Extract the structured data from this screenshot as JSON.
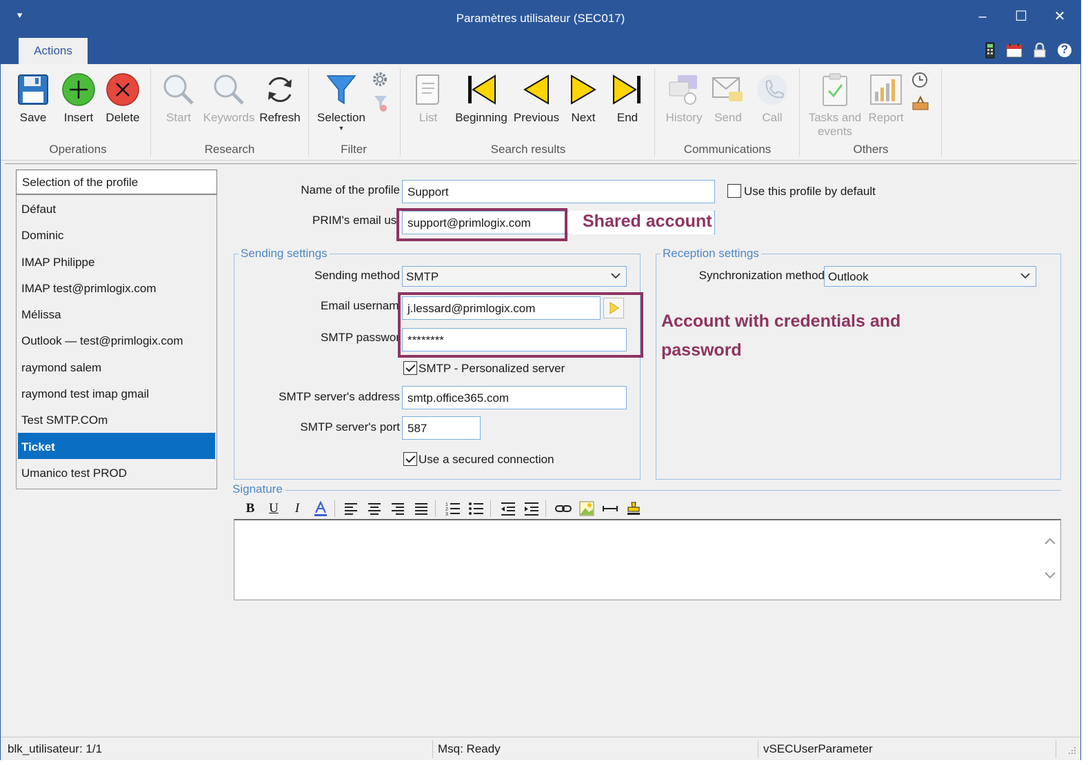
{
  "window": {
    "title": "Paramètres utilisateur (SEC017)",
    "system_menu_glyph": "⯆"
  },
  "window_controls": {
    "minimize": "–",
    "maximize": "☐",
    "close": "✕"
  },
  "tabs": {
    "actions": "Actions"
  },
  "tab_icons": [
    "calculator-icon",
    "calendar-icon",
    "lock-icon",
    "help-icon"
  ],
  "help_glyph": "?",
  "ribbon": {
    "buttons": {
      "save": "Save",
      "insert": "Insert",
      "delete": "Delete",
      "start": "Start",
      "keywords": "Keywords",
      "refresh": "Refresh",
      "selection": "Selection",
      "list": "List",
      "beginning": "Beginning",
      "previous": "Previous",
      "next": "Next",
      "end": "End",
      "history": "History",
      "send": "Send",
      "call": "Call",
      "tasks_line1": "Tasks and",
      "tasks_line2": "events",
      "report": "Report"
    },
    "groups": {
      "operations": "Operations",
      "research": "Research",
      "filter": "Filter",
      "search_results": "Search results",
      "communications": "Communications",
      "others": "Others"
    }
  },
  "profiles": {
    "header": "Selection of the profile",
    "items": [
      "Défaut",
      "Dominic",
      "IMAP Philippe",
      "IMAP test@primlogix.com",
      "Mélissa",
      "Outlook — test@primlogix.com",
      "raymond salem",
      "raymond test imap gmail",
      "Test SMTP.COm",
      "Ticket",
      "Umanico test PROD"
    ],
    "selected": "Ticket"
  },
  "form": {
    "profile_name_label": "Name of the profile",
    "profile_name_value": "Support",
    "default_checkbox_label": "Use this profile by default",
    "default_checked": false,
    "email_user_label": "PRIM's email user",
    "email_user_value": "support@primlogix.com"
  },
  "sending": {
    "legend": "Sending settings",
    "method_label": "Sending method",
    "method_value": "SMTP",
    "username_label": "Email username",
    "username_value": "j.lessard@primlogix.com",
    "password_label": "SMTP password",
    "password_value": "********",
    "personalized_label": "SMTP - Personalized server",
    "personalized_checked": true,
    "server_label": "SMTP server's address",
    "server_value": "smtp.office365.com",
    "port_label": "SMTP server's port",
    "port_value": "587",
    "secured_label": "Use a secured connection",
    "secured_checked": true
  },
  "reception": {
    "legend": "Reception settings",
    "sync_label": "Synchronization method",
    "sync_value": "Outlook"
  },
  "signature": {
    "legend": "Signature",
    "toolbar": {
      "bold": "B",
      "underline": "U",
      "italic": "I"
    }
  },
  "annotations": {
    "shared": "Shared account",
    "credentials_line1": "Account with credentials and",
    "credentials_line2": "password",
    "color": "#8e3461"
  },
  "status": {
    "block": "blk_utilisateur: 1/1",
    "message": "Msq: Ready",
    "view": "vSECUserParameter"
  },
  "colors": {
    "accent": "#2b579a",
    "selection": "#0a6fc2",
    "legend": "#4f86c4",
    "annotation": "#8e3461"
  }
}
